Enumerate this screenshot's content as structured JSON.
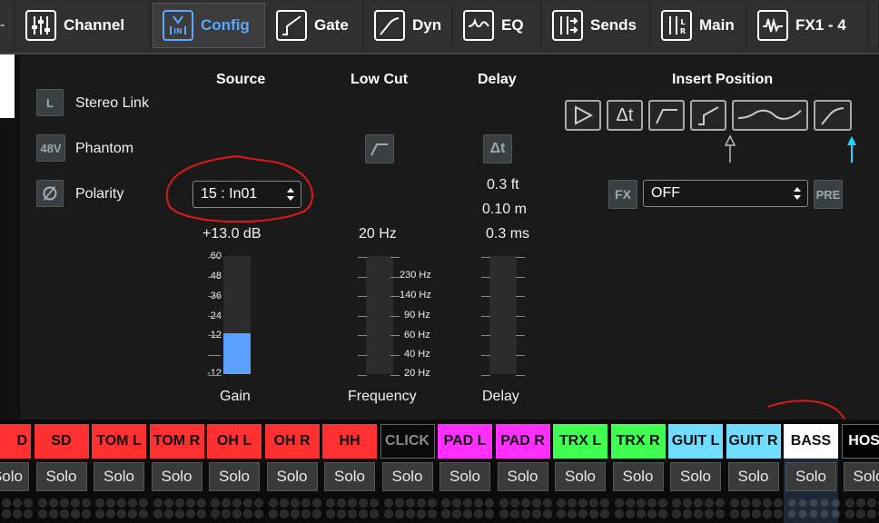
{
  "tabs": [
    {
      "label": "",
      "icon": "partial-icon"
    },
    {
      "label": "Channel",
      "icon": "faders-icon"
    },
    {
      "label": "Config",
      "icon": "input-config-icon",
      "active": true
    },
    {
      "label": "Gate",
      "icon": "gate-curve-icon"
    },
    {
      "label": "Dyn",
      "icon": "dynamics-curve-icon"
    },
    {
      "label": "EQ",
      "icon": "eq-curve-icon"
    },
    {
      "label": "Sends",
      "icon": "sends-icon"
    },
    {
      "label": "Main",
      "icon": "main-lr-icon"
    },
    {
      "label": "FX1 - 4",
      "icon": "fx-wave-icon"
    }
  ],
  "left_controls": {
    "stereo_link": {
      "button": "L",
      "label": "Stereo Link"
    },
    "phantom": {
      "button": "48V",
      "label": "Phantom"
    },
    "polarity": {
      "button": "∅",
      "label": "Polarity"
    }
  },
  "source": {
    "header": "Source",
    "selected": "15 : In01",
    "gain_value": "+13.0 dB",
    "gain_label": "Gain",
    "scale": [
      "60",
      "48",
      "36",
      "24",
      "12",
      "-12"
    ],
    "gain_level_percent": 35
  },
  "low_cut": {
    "header": "Low Cut",
    "frequency_value": "20 Hz",
    "frequency_label": "Frequency",
    "scale": [
      "230 Hz",
      "140 Hz",
      "90 Hz",
      "60 Hz",
      "40 Hz",
      "20 Hz"
    ]
  },
  "delay": {
    "header": "Delay",
    "button": "Δt",
    "feet": "0.3 ft",
    "meters": "0.10 m",
    "ms": "0.3 ms",
    "label": "Delay"
  },
  "insert": {
    "header": "Insert Position",
    "fx_button": "FX",
    "selected": "OFF",
    "pre_button": "PRE"
  },
  "channels": [
    {
      "name": "D",
      "color": "#ff3030",
      "text": "#111"
    },
    {
      "name": "SD",
      "color": "#ff3030",
      "text": "#111"
    },
    {
      "name": "TOM L",
      "color": "#ff3030",
      "text": "#111"
    },
    {
      "name": "TOM R",
      "color": "#ff3030",
      "text": "#111"
    },
    {
      "name": "OH L",
      "color": "#ff3030",
      "text": "#111"
    },
    {
      "name": "OH R",
      "color": "#ff3030",
      "text": "#111"
    },
    {
      "name": "HH",
      "color": "#ff3030",
      "text": "#111"
    },
    {
      "name": "CLICK",
      "color": "#0a0a0a",
      "text": "#888"
    },
    {
      "name": "PAD L",
      "color": "#ff30ff",
      "text": "#111"
    },
    {
      "name": "PAD R",
      "color": "#ff30ff",
      "text": "#111"
    },
    {
      "name": "TRX L",
      "color": "#40ff50",
      "text": "#111"
    },
    {
      "name": "TRX R",
      "color": "#40ff50",
      "text": "#111"
    },
    {
      "name": "GUIT L",
      "color": "#70dcff",
      "text": "#111"
    },
    {
      "name": "GUIT R",
      "color": "#70dcff",
      "text": "#111"
    },
    {
      "name": "BASS",
      "color": "#ffffff",
      "text": "#111"
    },
    {
      "name": "HOST",
      "color": "#000000",
      "text": "#fff"
    }
  ],
  "solo_label": "Solo"
}
